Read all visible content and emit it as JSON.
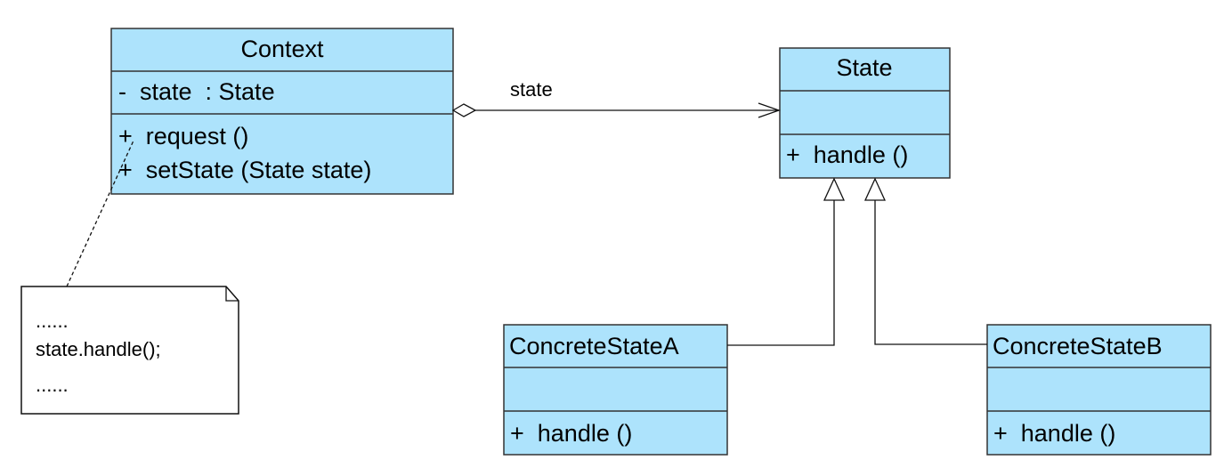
{
  "classes": {
    "context": {
      "name": "Context",
      "attributes": [
        "-  state  : State"
      ],
      "operations": [
        "+  request ()",
        "+  setState (State state)"
      ]
    },
    "state": {
      "name": "State",
      "attributes": [],
      "operations": [
        "+  handle ()"
      ]
    },
    "concrete_a": {
      "name": "ConcreteStateA",
      "attributes": [],
      "operations": [
        "+  handle ()"
      ]
    },
    "concrete_b": {
      "name": "ConcreteStateB",
      "attributes": [],
      "operations": [
        "+  handle ()"
      ]
    }
  },
  "association": {
    "label": "state",
    "type": "aggregation"
  },
  "note": {
    "lines": [
      "......",
      "state.handle();",
      "......"
    ]
  },
  "colors": {
    "class_fill": "#ade3fc",
    "line": "#111111"
  }
}
